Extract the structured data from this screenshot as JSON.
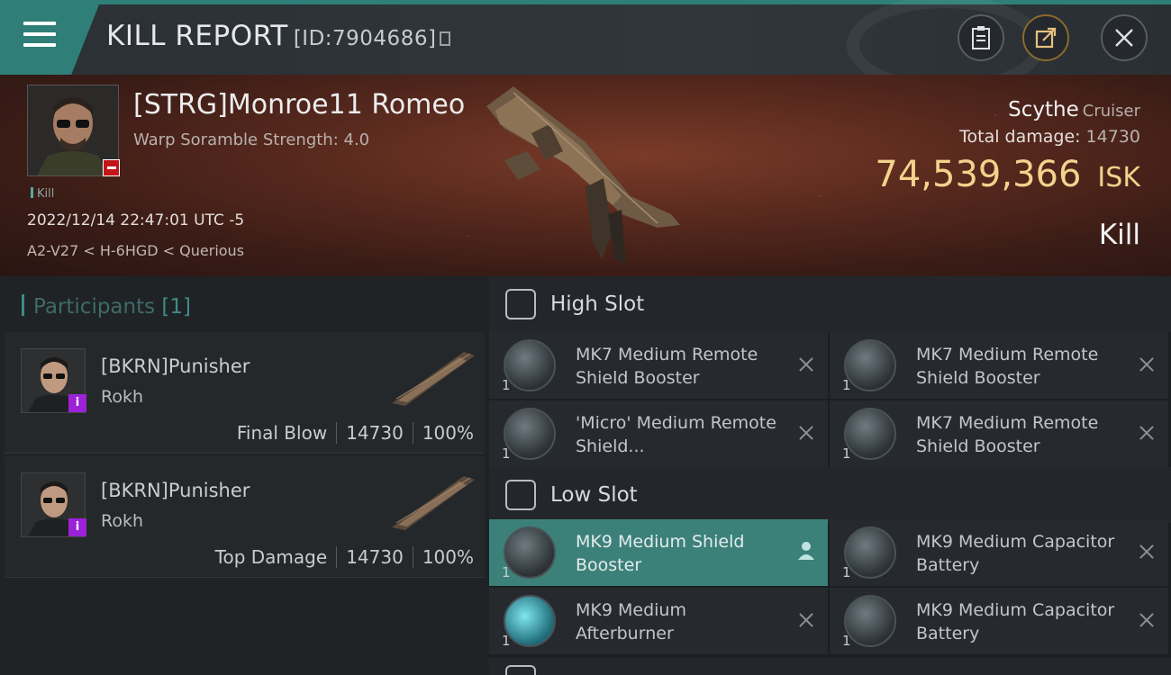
{
  "header": {
    "title": "KILL REPORT",
    "report_id": "[ID:7904686]"
  },
  "victim": {
    "name": "[STRG]Monroe11 Romeo",
    "warp_scramble": "Warp Soramble Strength: 4.0",
    "kill_tag": "Kill",
    "datetime": "2022/12/14 22:47:01 UTC -5",
    "location": "A2-V27 < H-6HGD < Querious",
    "ship_name": "Scythe",
    "ship_class": "Cruiser",
    "total_damage_label": "Total damage:",
    "total_damage_value": "14730",
    "isk_value": "74,539,366",
    "isk_unit": "ISK",
    "result": "Kill"
  },
  "participants": {
    "label": "Participants",
    "count": "[1]",
    "rows": [
      {
        "name": "[BKRN]Punisher",
        "ship": "Rokh",
        "role": "Final Blow",
        "damage": "14730",
        "percent": "100%"
      },
      {
        "name": "[BKRN]Punisher",
        "ship": "Rokh",
        "role": "Top Damage",
        "damage": "14730",
        "percent": "100%"
      }
    ]
  },
  "fitting": {
    "high_slot": {
      "title": "High Slot",
      "modules": [
        {
          "name": "MK7 Medium Remote Shield Booster",
          "qty": "1"
        },
        {
          "name": "MK7 Medium Remote Shield Booster",
          "qty": "1"
        },
        {
          "name": "'Micro' Medium Remote Shield...",
          "qty": "1"
        },
        {
          "name": "MK7 Medium Remote Shield Booster",
          "qty": "1"
        }
      ]
    },
    "low_slot": {
      "title": "Low Slot",
      "modules": [
        {
          "name": "MK9 Medium Shield Booster",
          "qty": "1"
        },
        {
          "name": "MK9 Medium Capacitor Battery",
          "qty": "1"
        },
        {
          "name": "MK9 Medium Afterburner",
          "qty": "1"
        },
        {
          "name": "MK9 Medium Capacitor Battery",
          "qty": "1"
        }
      ]
    }
  },
  "colors": {
    "accent_teal": "#2f7e77",
    "isk_gold": "#f2d28c",
    "victim_badge_red": "#c2161b",
    "info_badge_purple": "#9b22d6"
  }
}
